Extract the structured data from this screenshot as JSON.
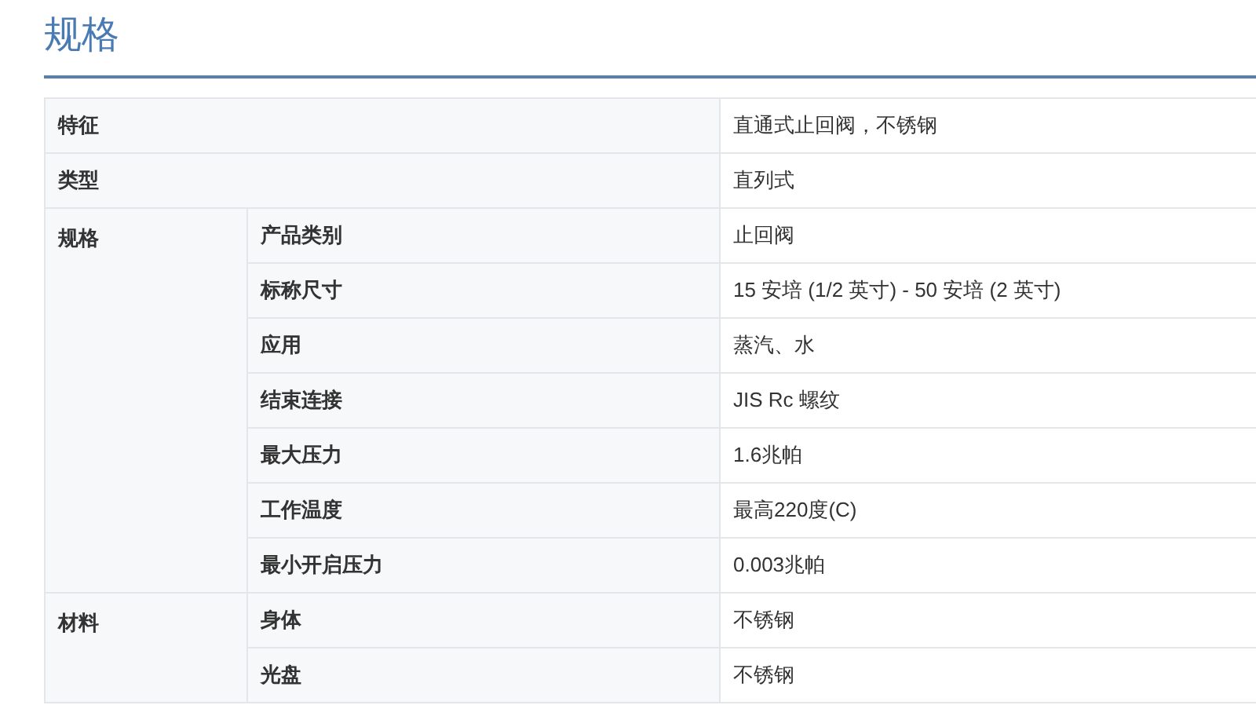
{
  "title": "规格",
  "rows": [
    {
      "kind": "single",
      "label": "特征",
      "value": "直通式止回阀，不锈钢"
    },
    {
      "kind": "single",
      "label": "类型",
      "value": "直列式"
    },
    {
      "kind": "group",
      "label": "规格",
      "items": [
        {
          "label": "产品类别",
          "value": "止回阀"
        },
        {
          "label": "标称尺寸",
          "value": "15 安培 (1/2 英寸) - 50 安培 (2 英寸)"
        },
        {
          "label": "应用",
          "value": "蒸汽、水"
        },
        {
          "label": "结束连接",
          "value": "JIS Rc 螺纹"
        },
        {
          "label": "最大压力",
          "value": "1.6兆帕"
        },
        {
          "label": "工作温度",
          "value": "最高220度(C)"
        },
        {
          "label": "最小开启压力",
          "value": "0.003兆帕"
        }
      ]
    },
    {
      "kind": "group",
      "label": "材料",
      "items": [
        {
          "label": "身体",
          "value": "不锈钢"
        },
        {
          "label": "光盘",
          "value": "不锈钢"
        }
      ]
    }
  ]
}
